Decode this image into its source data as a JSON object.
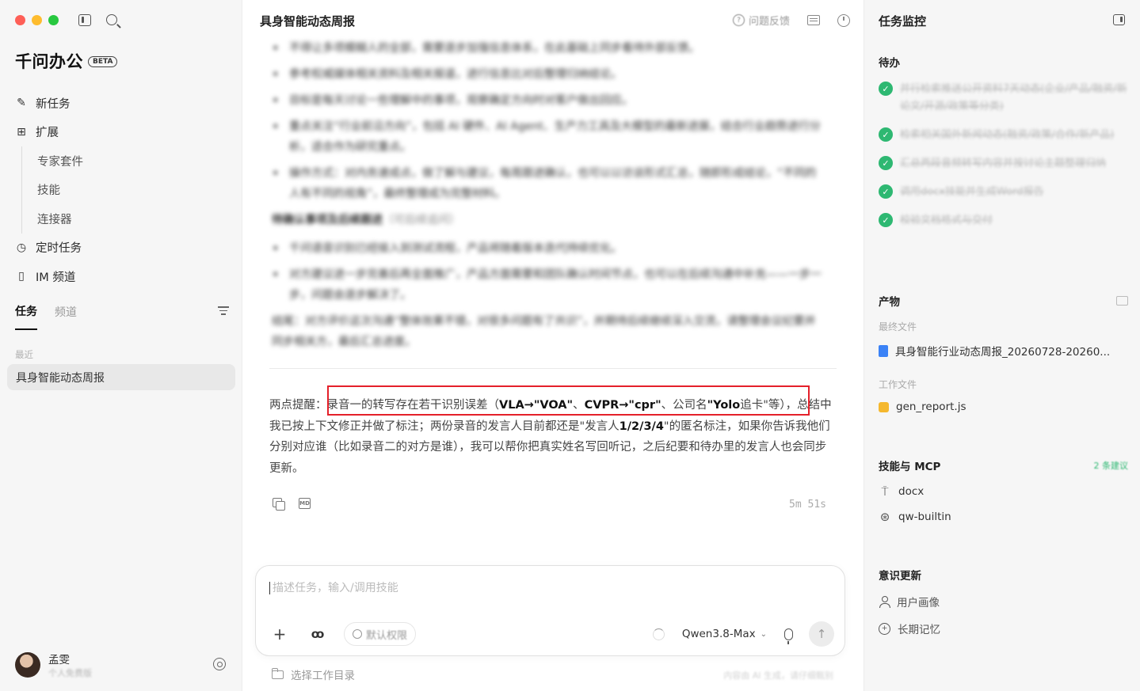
{
  "window": {
    "brand": "千问办公",
    "badge": "BETA"
  },
  "sidebar": {
    "nav": [
      {
        "label": "新任务",
        "icon": "edit-icon"
      },
      {
        "label": "扩展",
        "icon": "extension-icon"
      }
    ],
    "sub_nav": [
      "专家套件",
      "技能",
      "连接器"
    ],
    "nav2": [
      {
        "label": "定时任务",
        "icon": "clock-icon"
      },
      {
        "label": "IM 频道",
        "icon": "phone-icon"
      }
    ],
    "tabs": [
      "任务",
      "频道"
    ],
    "recent_label": "最近",
    "recent_items": [
      "具身智能动态周报"
    ],
    "user": {
      "name": "孟雯",
      "plan": "个人免费版"
    }
  },
  "main": {
    "title": "具身智能动态周报",
    "feedback_label": "问题反馈",
    "blurred_bullets": [
      "不得让多项模糊人的全部，需要逐步加强信息体系，在此基础上同步看待外部反馈。",
      "参考权威媒体相关资料及相关报道，进行信息比对后整理归纳结论。",
      "目标是每天讨论一些理解中的事项，观察确定方向时对客户做出回应。",
      "重点关注“行业前沿方向”，包括 AI 硬件、AI Agent、生产力工具及大模型的最新进展，结合行业趋势进行分析，适合作为研究重点。",
      "操作方式：对内务速成点，做了解与建议，每周跟进确认，也可以以访谈形式汇总，随即形成结论，“不同的人有不同的视角”，最终整理成为完整材料。"
    ],
    "blurred_heading": "待确认事项及后续跟进",
    "blurred_heading_note": "（可后续追问）",
    "blurred_bullets_2": [
      "千问语音识别已经接入到测试流程，产品将随着版本迭代持续优化。",
      "对方建议进一步完善后再全面推广，产品方面需要和团队确认时间节点，也可以在后续沟通中补充——一步一步，问题会逐步解决了。"
    ],
    "blurred_summary": "结尾：对方评价这次沟通“整体效果不错，对很多问题有了共识”，并期待后续继续深入交流，请整理会议纪要并同步相关方，最后汇总进度。",
    "notice_prefix": "两点提醒：",
    "notice_part1": "录音一的转写存在若干识别误差（",
    "notice_b1": "VLA→\"VOA\"",
    "notice_sep1": "、",
    "notice_b2": "CVPR→\"cpr\"",
    "notice_part2": "、公司名",
    "notice_b3": "\"Yolo",
    "notice_part3": "追卡\"等），总结中我已按上下文修正并做了标注；两份录音的发言人目前都还是\"发言人",
    "notice_b4": "1/2/3/4",
    "notice_part4": "\"的匿名标注，如果你告诉我他们分别对应谁（比如录音二的对方是谁），我可以帮你把真实姓名写回听记，之后纪要和待办里的发言人也会同步更新。",
    "elapsed": "5m 51s"
  },
  "composer": {
    "placeholder": "描述任务，输入/调用技能",
    "permission_label": "默认权限",
    "model": "Qwen3.8-Max",
    "workdir_label": "选择工作目录",
    "disclaimer": "内容由 AI 生成，请仔细甄别"
  },
  "panel": {
    "title": "任务监控",
    "todo_head": "待办",
    "todos": [
      "并行检索推送公开资料7天动态(企业/产品/融资/新论文/开源/政策等分类)",
      "检索相关国外新闻动态(融资/政策/合作/新产品)",
      "汇总两段音频转写内容并按讨论主题整理归纳",
      "调用docx技能并生成Word报告",
      "校验文档格式与交付"
    ],
    "output_head": "产物",
    "final_label": "最终文件",
    "final_file": "具身智能行业动态周报_20260728-20260...",
    "work_label": "工作文件",
    "work_file": "gen_report.js",
    "skills_head": "技能与 MCP",
    "skills_badge": "2 条建议",
    "skills": [
      {
        "label": "docx",
        "icon": "pin-icon"
      },
      {
        "label": "qw-builtin",
        "icon": "network-icon"
      }
    ],
    "memory_head": "意识更新",
    "memory": [
      "用户画像",
      "长期记忆"
    ]
  },
  "colors": {
    "accent_red": "#e4202a",
    "check_green": "#2eb872"
  }
}
